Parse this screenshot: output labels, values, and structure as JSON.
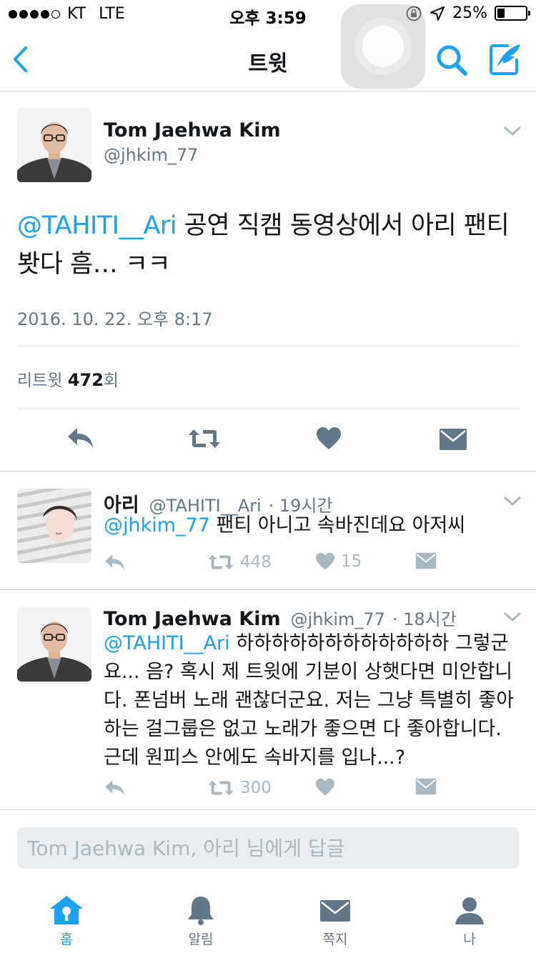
{
  "status_bar": {
    "carrier": "KT",
    "network": "LTE",
    "time": "오후 3:59",
    "battery": "25%",
    "battery_level": 0.25
  },
  "nav": {
    "title": "트윗"
  },
  "main_tweet": {
    "name": "Tom Jaehwa Kim",
    "handle": "@jhkim_77",
    "mention": "@TAHITI__Ari",
    "text": " 공연 직캠 동영상에서 아리 팬티 봣다 흠… ㅋㅋ",
    "date": "2016. 10. 22. 오후 8:17",
    "retweet_label": "리트윗",
    "retweet_count": "472",
    "retweet_suffix": "회"
  },
  "replies": [
    {
      "name": "아리",
      "handle": "@TAHITI__Ari",
      "time": "· 19시간",
      "mention": "@jhkim_77",
      "text": " 팬티 아니고 속바진데요 아저씨",
      "retweets": "448",
      "likes": "15"
    },
    {
      "name": "Tom Jaehwa Kim",
      "handle": "@jhkim_77",
      "time": "· 18시간",
      "mention": "@TAHITI__Ari",
      "text": " 하하하하하하하하하하하하 그렇군요... 음? 혹시 제 트윗에 기분이 상햇다면 미안합니다. 폰넘버 노래 괜찮더군요. 저는 그냥 특별히 좋아하는 걸그룹은 없고 노래가 좋으면 다 좋아합니다. 근데 원피스 안에도 속바지를 입나...?",
      "retweets": "300",
      "likes": ""
    }
  ],
  "reply_input": {
    "placeholder": "Tom Jaehwa Kim, 아리 님에게 답글"
  },
  "tabs": [
    {
      "label": "홈",
      "icon": "home-icon"
    },
    {
      "label": "알림",
      "icon": "bell-icon"
    },
    {
      "label": "쪽지",
      "icon": "envelope-icon"
    },
    {
      "label": "나",
      "icon": "profile-icon"
    }
  ],
  "colors": {
    "accent": "#1da1f2",
    "secondary_text": "#657786",
    "icon_gray": "#aab8c2",
    "action_gray": "#657786"
  }
}
